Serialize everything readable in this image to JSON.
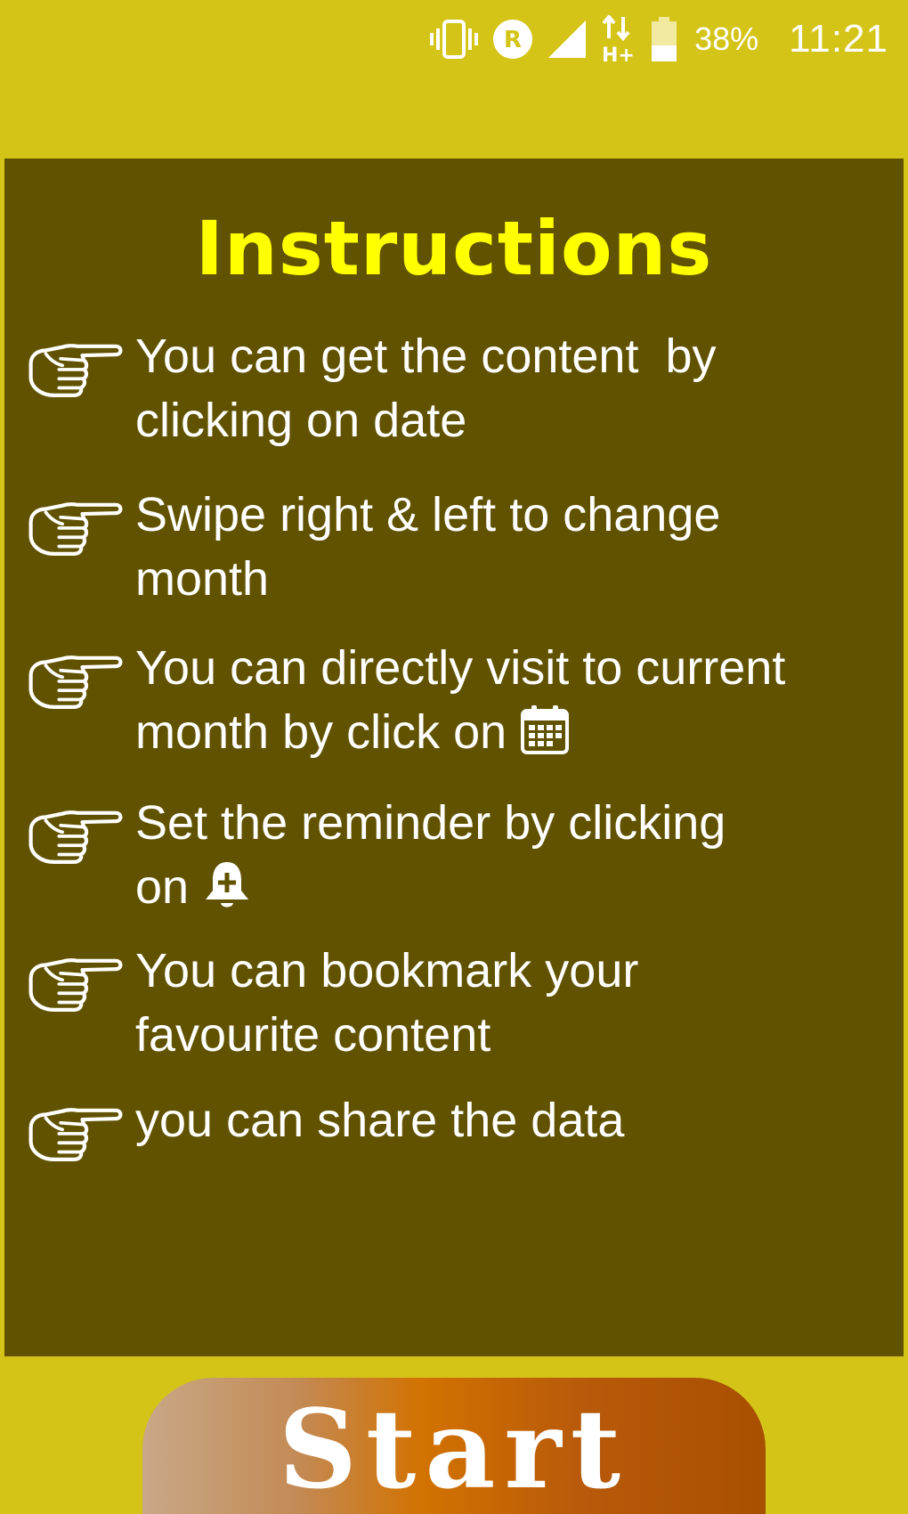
{
  "status_bar": {
    "icons": [
      "vibrate-icon",
      "roaming-icon",
      "signal-icon",
      "data-hplus-icon",
      "battery-icon"
    ],
    "battery": "38%",
    "time": "11:21"
  },
  "instructions": {
    "title": "Instructions",
    "items": [
      {
        "icon": "pointing-hand-icon",
        "line1": "You can get the content  by",
        "line2": "clicking on date"
      },
      {
        "icon": "pointing-hand-icon",
        "line1": "Swipe right & left to change",
        "line2": "month"
      },
      {
        "icon": "pointing-hand-icon",
        "line1": "You can directly visit to current",
        "line2": "month by click on",
        "inline_icon": "calendar-icon"
      },
      {
        "icon": "pointing-hand-icon",
        "line1": "Set the reminder by clicking",
        "line2": "on",
        "inline_icon": "add-reminder-bell-icon"
      },
      {
        "icon": "pointing-hand-icon",
        "line1": "You can bookmark your",
        "line2": "favourite content"
      },
      {
        "icon": "pointing-hand-icon",
        "line1": "you can share the data",
        "line2": ""
      }
    ]
  },
  "start_button": {
    "label": "Start"
  },
  "colors": {
    "background": "#d4c418",
    "panel": "#615200",
    "title": "#ffff00",
    "text": "#ffffff"
  }
}
